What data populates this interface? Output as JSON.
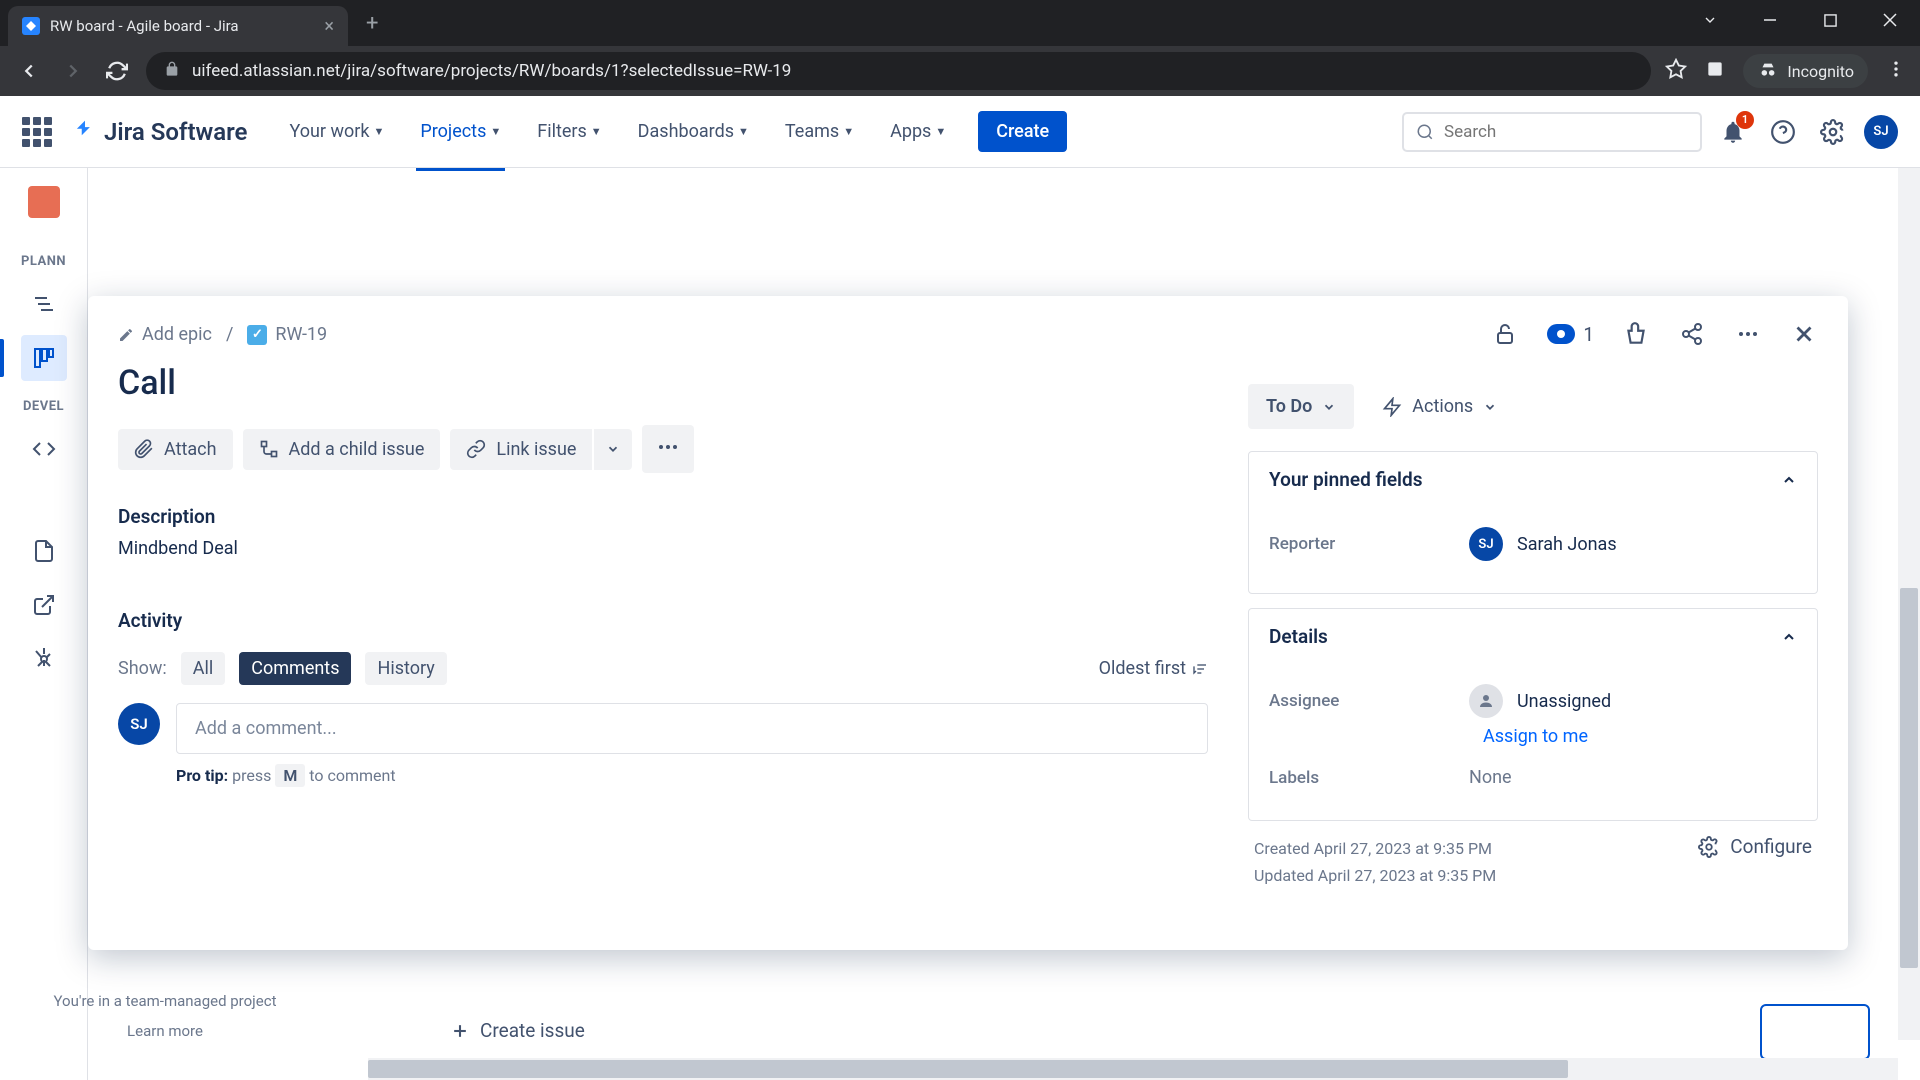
{
  "browser": {
    "tab_title": "RW board - Agile board - Jira",
    "url": "uifeed.atlassian.net/jira/software/projects/RW/boards/1?selectedIssue=RW-19",
    "incognito_label": "Incognito"
  },
  "nav": {
    "logo_text": "Jira Software",
    "items": [
      "Your work",
      "Projects",
      "Filters",
      "Dashboards",
      "Teams",
      "Apps"
    ],
    "active_index": 1,
    "create_label": "Create",
    "search_placeholder": "Search",
    "notification_count": "1",
    "avatar_initials": "SJ"
  },
  "sidebar": {
    "planning_label": "PLANN",
    "dev_label": "DEVEL"
  },
  "board_bg": {
    "footer_text": "You're in a team-managed project",
    "learn_more": "Learn more",
    "create_issue": "Create issue"
  },
  "issue": {
    "breadcrumb": {
      "add_epic": "Add epic",
      "separator": "/",
      "key": "RW-19"
    },
    "title": "Call",
    "actions": {
      "attach": "Attach",
      "add_child": "Add a child issue",
      "link": "Link issue"
    },
    "description_label": "Description",
    "description_text": "Mindbend Deal",
    "activity": {
      "label": "Activity",
      "show_label": "Show:",
      "tabs": [
        "All",
        "Comments",
        "History"
      ],
      "active_tab": 1,
      "sort_label": "Oldest first",
      "comment_placeholder": "Add a comment...",
      "pro_tip_label": "Pro tip:",
      "pro_tip_press": "press",
      "pro_tip_key": "M",
      "pro_tip_rest": "to comment",
      "avatar_initials": "SJ"
    },
    "watch_count": "1",
    "status": {
      "value": "To Do",
      "actions_label": "Actions"
    },
    "pinned": {
      "header": "Your pinned fields",
      "reporter_label": "Reporter",
      "reporter_name": "Sarah Jonas",
      "reporter_initials": "SJ"
    },
    "details": {
      "header": "Details",
      "assignee_label": "Assignee",
      "assignee_value": "Unassigned",
      "assign_to_me": "Assign to me",
      "labels_label": "Labels",
      "labels_value": "None"
    },
    "meta": {
      "created": "Created April 27, 2023 at 9:35 PM",
      "updated": "Updated April 27, 2023 at 9:35 PM",
      "configure": "Configure"
    }
  }
}
